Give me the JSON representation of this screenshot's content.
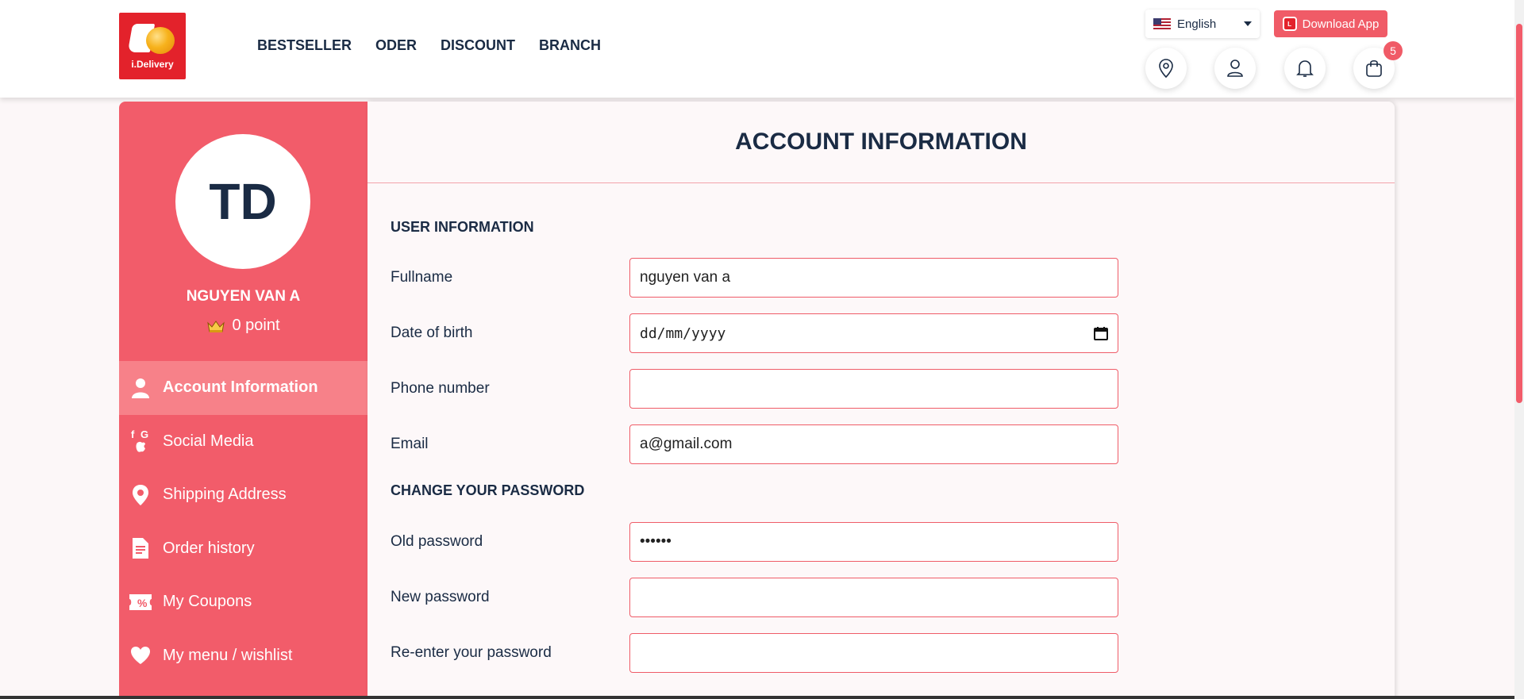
{
  "logo": {
    "brand_text": "i.Delivery"
  },
  "nav": {
    "items": [
      "BESTSELLER",
      "ODER",
      "DISCOUNT",
      "BRANCH"
    ]
  },
  "language": {
    "selected": "English"
  },
  "download_app": {
    "label": "Download App"
  },
  "header_icons": {
    "cart_count": "5"
  },
  "profile": {
    "initials": "TD",
    "name": "NGUYEN VAN A",
    "points": "0 point"
  },
  "sidebar": {
    "items": [
      {
        "label": "Account Information",
        "icon": "user-icon",
        "active": true
      },
      {
        "label": "Social Media",
        "icon": "social-icon"
      },
      {
        "label": "Shipping Address",
        "icon": "location-pin-icon"
      },
      {
        "label": "Order history",
        "icon": "document-icon"
      },
      {
        "label": "My Coupons",
        "icon": "coupon-icon"
      },
      {
        "label": "My menu / wishlist",
        "icon": "heart-icon"
      }
    ]
  },
  "content": {
    "title": "ACCOUNT INFORMATION",
    "user_section": "USER INFORMATION",
    "password_section": "CHANGE YOUR PASSWORD",
    "fields": {
      "fullname": {
        "label": "Fullname",
        "value": "nguyen van a"
      },
      "dob": {
        "label": "Date of birth",
        "value": "dd/mm/yyyy"
      },
      "phone": {
        "label": "Phone number",
        "value": ""
      },
      "email": {
        "label": "Email",
        "value": "a@gmail.com"
      },
      "old_password": {
        "label": "Old password",
        "value": "••••••"
      },
      "new_password": {
        "label": "New password",
        "value": ""
      },
      "reenter_password": {
        "label": "Re-enter your password",
        "value": ""
      }
    }
  },
  "colors": {
    "accent": "#f25c6a",
    "active_item": "#f78189",
    "text": "#1a2b44",
    "logo_red": "#e3222b"
  }
}
